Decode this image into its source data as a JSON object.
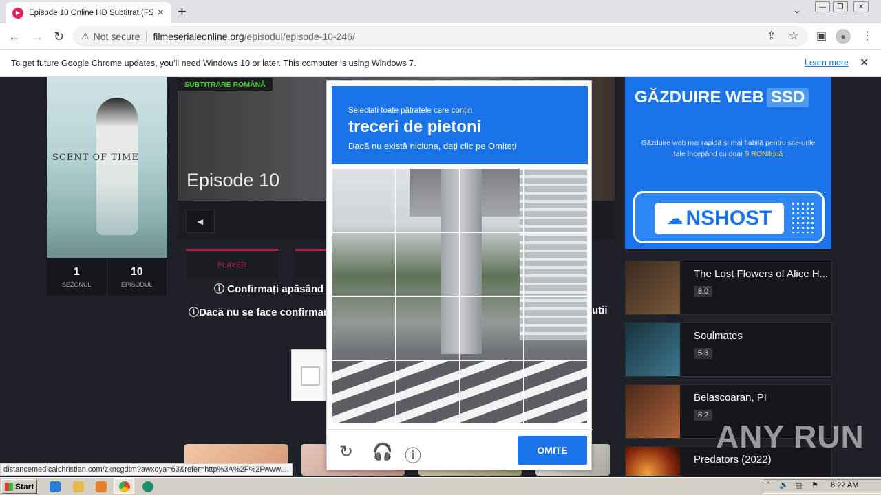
{
  "browser": {
    "tab_title": "Episode 10 Online HD Subtitrat (FSC",
    "new_tab_glyph": "+",
    "security_label": "Not secure",
    "url_domain": "filmeserialeonline.org",
    "url_path": "/episodul/episode-10-246/"
  },
  "infobar": {
    "message": "To get future Google Chrome updates, you'll need Windows 10 or later. This computer is using Windows 7.",
    "learn_more": "Learn more"
  },
  "page": {
    "subtitle_tag": "SUBTITRARE ROMÂNĂ",
    "episode_title": "Episode 10",
    "poster_title": "SCENT OF TIME",
    "stats": [
      {
        "value": "1",
        "label": "SEZONUL"
      },
      {
        "value": "10",
        "label": "EPISODUL"
      }
    ],
    "player_tab": "PLAYER",
    "confirm_text_1": "Confirmați apăsând c",
    "confirm_text_2": "Dacă nu se face confirmare",
    "confirm_text_2_tail": "utii"
  },
  "ad": {
    "heading": "GĂZDUIRE WEB",
    "heading_badge": "SSD",
    "text_before": "Găzduire web mai rapidă și mai fiabilă pentru site-urile tale începând cu doar ",
    "text_price": "9 RON/lună",
    "logo": "NSHOST"
  },
  "recommendations": [
    {
      "title": "The Lost Flowers of Alice H...",
      "score": "8.0"
    },
    {
      "title": "Soulmates",
      "score": "5.3"
    },
    {
      "title": "Belascoaran, PI",
      "score": "8.2"
    },
    {
      "title": "Predators (2022)",
      "score": ""
    }
  ],
  "captcha": {
    "instruction_small": "Selectați toate pătratele care conțin",
    "target": "treceri de pietoni",
    "hint": "Dacă nu există niciuna, dați clic pe Omiteți",
    "skip_label": "OMITE",
    "icons": [
      "reload-icon",
      "audio-icon",
      "info-icon"
    ]
  },
  "status_url": "distancemedicalchristian.com/zkncgdtm?awxoya=63&refer=http%3A%2F%2Fwww....",
  "watermark": "ANY RUN",
  "taskbar": {
    "start_label": "Start",
    "clock": "8:22 AM"
  },
  "colors": {
    "accent": "#1a73e8",
    "brand_red": "#c21f4a",
    "subtitle_green": "#4cd137"
  }
}
